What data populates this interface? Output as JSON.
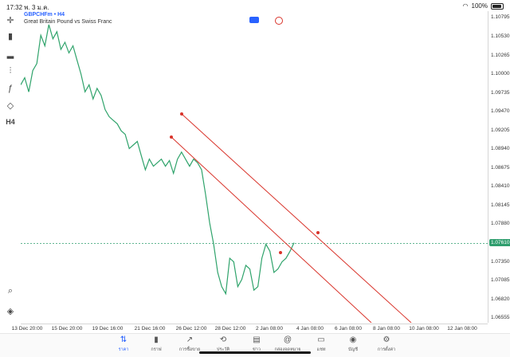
{
  "status_bar": {
    "time": "17:32",
    "date": "พ. 3 ม.ค.",
    "battery": "100%"
  },
  "symbol": {
    "ticker": "GBPCHFm • H4",
    "description": "Great Britain Pound vs Swiss Franc"
  },
  "left_toolbar": {
    "items": [
      {
        "name": "crosshair-icon",
        "glyph": "✛"
      },
      {
        "name": "candles-icon",
        "glyph": "▮"
      },
      {
        "name": "bars-icon",
        "glyph": "▂"
      },
      {
        "name": "indicators-icon",
        "glyph": "⫶"
      },
      {
        "name": "function-icon",
        "glyph": "ƒ"
      },
      {
        "name": "objects-icon",
        "glyph": "◇"
      },
      {
        "name": "timeframe-button",
        "glyph": "H4"
      }
    ]
  },
  "price_axis": {
    "labels": [
      "1.10795",
      "1.10530",
      "1.10265",
      "1.10000",
      "1.09735",
      "1.09470",
      "1.09205",
      "1.08940",
      "1.08675",
      "1.08410",
      "1.08145",
      "1.07880",
      "1.07610",
      "1.07350",
      "1.07085",
      "1.06820",
      "1.06555"
    ],
    "current_price": "1.07610",
    "current_color": "#2f9e6e"
  },
  "time_axis": {
    "labels": [
      "13 Dec 20:00",
      "15 Dec 20:00",
      "19 Dec 16:00",
      "21 Dec 16:00",
      "26 Dec 12:00",
      "28 Dec 12:00",
      "2 Jan 08:00",
      "4 Jan 08:00",
      "6 Jan 08:00",
      "8 Jan 08:00",
      "10 Jan 08:00",
      "12 Jan 08:00"
    ]
  },
  "chart_data": {
    "type": "line",
    "series": [
      {
        "color": "#2fa36b",
        "values": [
          1.0985,
          1.0995,
          1.0975,
          1.1005,
          1.1015,
          1.1055,
          1.104,
          1.107,
          1.105,
          1.106,
          1.1035,
          1.1045,
          1.103,
          1.104,
          1.102,
          1.1,
          1.0975,
          1.0985,
          1.0965,
          1.098,
          1.097,
          1.095,
          1.094,
          1.0935,
          1.093,
          1.092,
          1.0915,
          1.0895,
          1.09,
          1.0905,
          1.0885,
          1.0865,
          1.088,
          1.087,
          1.0875,
          1.088,
          1.087,
          1.0878,
          1.086,
          1.088,
          1.089,
          1.088,
          1.087,
          1.088,
          1.0875,
          1.0865,
          1.083,
          1.079,
          1.076,
          1.072,
          1.07,
          1.069,
          1.074,
          1.0735,
          1.07,
          1.071,
          1.073,
          1.0725,
          1.0695,
          1.07,
          1.074,
          1.076,
          1.075,
          1.072,
          1.0725,
          1.0735,
          1.074,
          1.075,
          1.0762
        ]
      }
    ],
    "ylim": [
      1.0649,
      1.1089
    ],
    "trend_lines": [
      {
        "color": "#d9342b",
        "from": {
          "time": "21 Dec 16:00",
          "price": 1.0944
        },
        "to": {
          "time": "12 Jan 08:00",
          "price": 1.0634
        },
        "anchor": {
          "time": "4 Jan 08:00",
          "price": 1.0759
        }
      },
      {
        "color": "#d9342b",
        "from": {
          "time": "21 Dec 12:00",
          "price": 1.0912
        },
        "to": {
          "time": "8 Jan 08:00",
          "price": 1.0634
        },
        "anchor": {
          "time": "2 Jan 08:00",
          "price": 1.0735
        }
      }
    ]
  },
  "bottom_nav": {
    "items": [
      {
        "label": "ราคา",
        "glyph": "⇅",
        "active": true
      },
      {
        "label": "กราฟ",
        "glyph": "▮",
        "active": false
      },
      {
        "label": "การซื้อขาย",
        "glyph": "↗",
        "active": false
      },
      {
        "label": "ประวัติ",
        "glyph": "⟲",
        "active": false
      },
      {
        "label": "ข่าว",
        "glyph": "▤",
        "active": false
      },
      {
        "label": "กล่องจดหมาย",
        "glyph": "@",
        "active": false
      },
      {
        "label": "แชท",
        "glyph": "▭",
        "active": false
      },
      {
        "label": "บัญชี",
        "glyph": "◉",
        "active": false
      },
      {
        "label": "การตั้งค่า",
        "glyph": "⚙",
        "active": false
      }
    ]
  }
}
